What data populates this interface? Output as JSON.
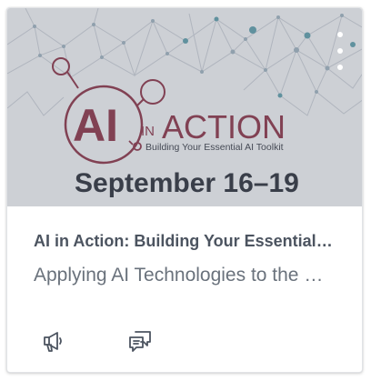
{
  "card": {
    "image": {
      "logo_ai": "AI",
      "logo_in": "IN",
      "logo_action": "ACTION",
      "logo_tagline": "Building Your Essential AI Toolkit",
      "dates": "September 16–19"
    },
    "title": "AI in Action: Building Your Essential AI Toolkit",
    "subtitle": "Applying AI Technologies to the Workplace",
    "colors": {
      "accent": "#8b3346",
      "title_text": "#4c5460",
      "subtitle_text": "#6a727c"
    },
    "options_icon": "kebab-vertical-icon",
    "actions": [
      {
        "icon": "announcements-megaphone-icon"
      },
      {
        "icon": "discussions-chat-icon"
      }
    ]
  }
}
